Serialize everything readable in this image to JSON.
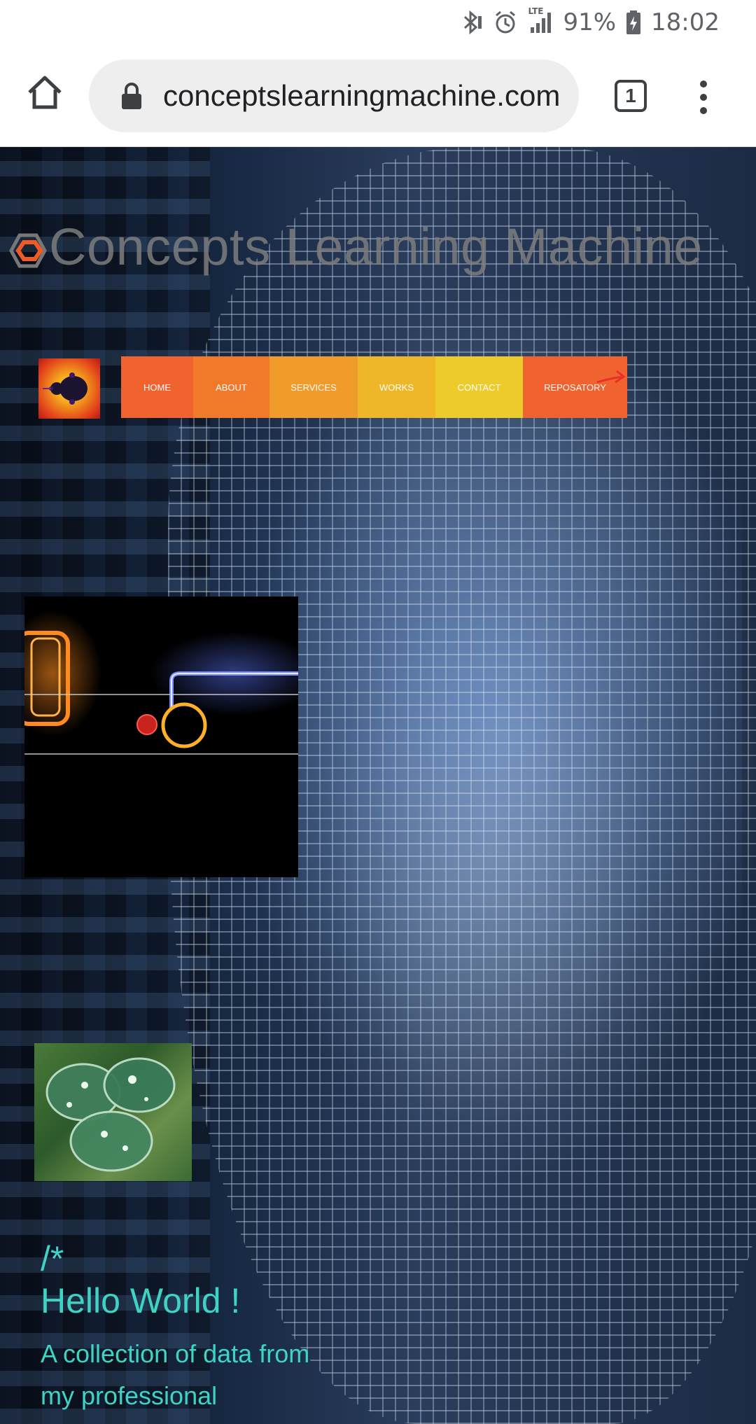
{
  "status_bar": {
    "network_type": "LTE",
    "battery_percent": "91%",
    "time": "18:02"
  },
  "browser": {
    "url": "conceptslearningmachine.com",
    "tab_count": "1"
  },
  "site": {
    "title": "Concepts Learning Machine",
    "nav": [
      {
        "label": "HOME",
        "color": "#f0622e"
      },
      {
        "label": "ABOUT",
        "color": "#f07a2a"
      },
      {
        "label": "SERVICES",
        "color": "#f19b2a"
      },
      {
        "label": "WORKS",
        "color": "#eeb72a"
      },
      {
        "label": "CONTACT",
        "color": "#eccb2a"
      },
      {
        "label": "REPOSATORY",
        "color": "#f0622e"
      }
    ],
    "intro": {
      "comment": "/*",
      "greeting": "Hello World !",
      "description": "A collection of data from my professional"
    }
  },
  "colors": {
    "accent_text": "#3fd3c4",
    "title_gray": "#7d7d7d"
  }
}
